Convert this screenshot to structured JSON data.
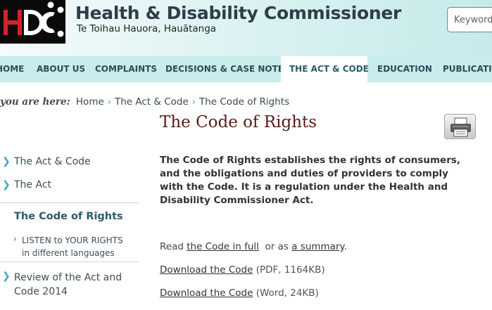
{
  "header": {
    "logo_text": "HDC",
    "title": "Health & Disability Commissioner",
    "subtitle": "Te Toihau Hauora, Hauātanga",
    "search_placeholder": "Keyword"
  },
  "nav": {
    "items": [
      {
        "label": "HOME"
      },
      {
        "label": "ABOUT US"
      },
      {
        "label": "COMPLAINTS"
      },
      {
        "label": "DECISIONS & CASE NOTES"
      },
      {
        "label": "THE ACT & CODE",
        "active": true
      },
      {
        "label": "EDUCATION"
      },
      {
        "label": "PUBLICATIONS"
      }
    ]
  },
  "breadcrumb": {
    "label": "you are here:",
    "items": [
      "Home",
      "The Act & Code",
      "The Code of Rights"
    ]
  },
  "sidebar": {
    "items": [
      {
        "label": "The Act & Code"
      },
      {
        "label": "The Act"
      },
      {
        "label": "The Code of Rights",
        "active": true
      },
      {
        "label_line1": "LISTEN to YOUR RIGHTS",
        "label_line2": "in different languages"
      },
      {
        "label": "Review of the Act and Code 2014"
      }
    ]
  },
  "main": {
    "title": "The Code of Rights",
    "print_icon": "printer-icon",
    "intro": "The Code of Rights establishes the rights of consumers, and the obligations and duties of providers to comply with the Code. It is a regulation under the Health and Disability Commissioner Act.",
    "read": {
      "prefix": "Read",
      "link1": "the Code in full",
      "middle": "or as",
      "link2": "a summary",
      "suffix": "."
    },
    "downloads": [
      {
        "label": "Download the Code",
        "meta": "(PDF, 1164KB)"
      },
      {
        "label": "Download the Code",
        "meta": "(Word, 24KB)"
      }
    ]
  },
  "colors": {
    "header_bg": "#d9f1f1",
    "nav_bg": "#c9ecec",
    "title_color": "#5a1a1a",
    "accent": "#3aa8c0",
    "logo_red": "#d4222a"
  }
}
